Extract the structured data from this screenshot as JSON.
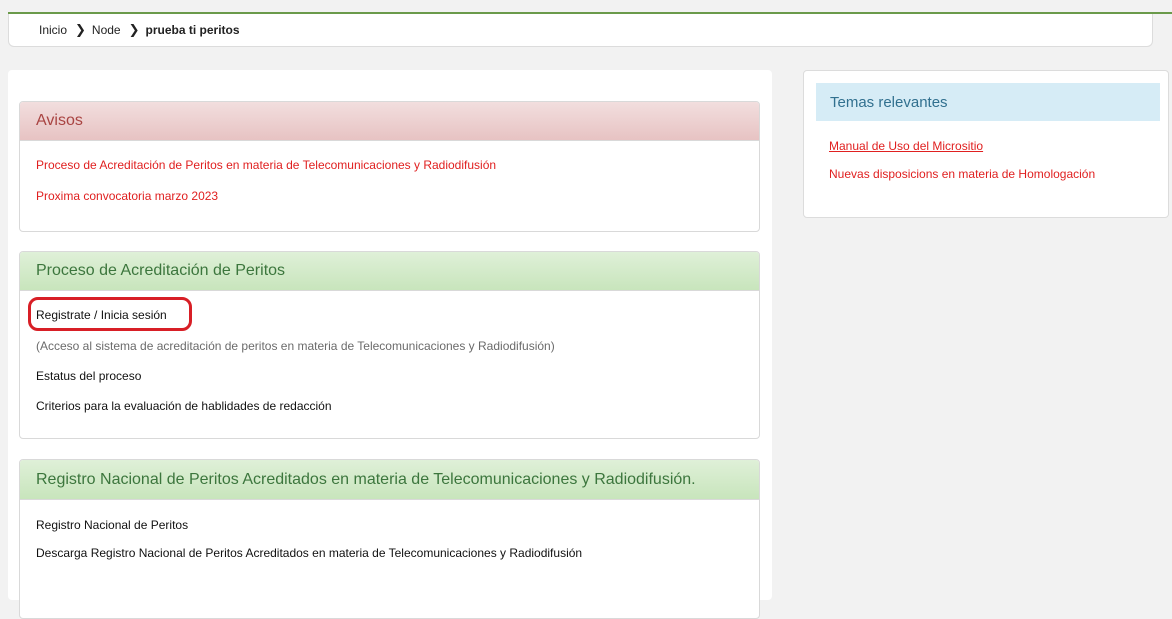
{
  "breadcrumb": {
    "home": "Inicio",
    "node": "Node",
    "current": "prueba ti peritos",
    "separator": "❯"
  },
  "avisos": {
    "title": "Avisos",
    "links": [
      "Proceso de Acreditación de Peritos en materia de Telecomunicaciones y Radiodifusión",
      "Proxima convocatoria marzo 2023"
    ]
  },
  "proceso": {
    "title": "Proceso de Acreditación de Peritos",
    "register_link": "Registrate / Inicia sesión",
    "register_note": "(Acceso al sistema de acreditación de peritos en materia de Telecomunicaciones y Radiodifusión)",
    "status_link": "Estatus del proceso",
    "criteria_link": "Criterios para la evaluación de hablidades de redacción"
  },
  "registro": {
    "title": "Registro Nacional de Peritos Acreditados en materia de Telecomunicaciones y Radiodifusión.",
    "links": [
      "Registro Nacional de Peritos",
      "Descarga Registro Nacional de Peritos Acreditados en materia de Telecomunicaciones y Radiodifusión"
    ]
  },
  "temas": {
    "title": "Temas relevantes",
    "links": [
      "Manual de Uso del Micrositio",
      "Nuevas disposicions en materia de Homologación"
    ]
  },
  "colors": {
    "link_red": "#e02020",
    "annotation_red": "#d81f26",
    "avisos_header": "#f2dede",
    "proceso_header": "#dff0d8",
    "temas_header": "#d6ecf6"
  }
}
